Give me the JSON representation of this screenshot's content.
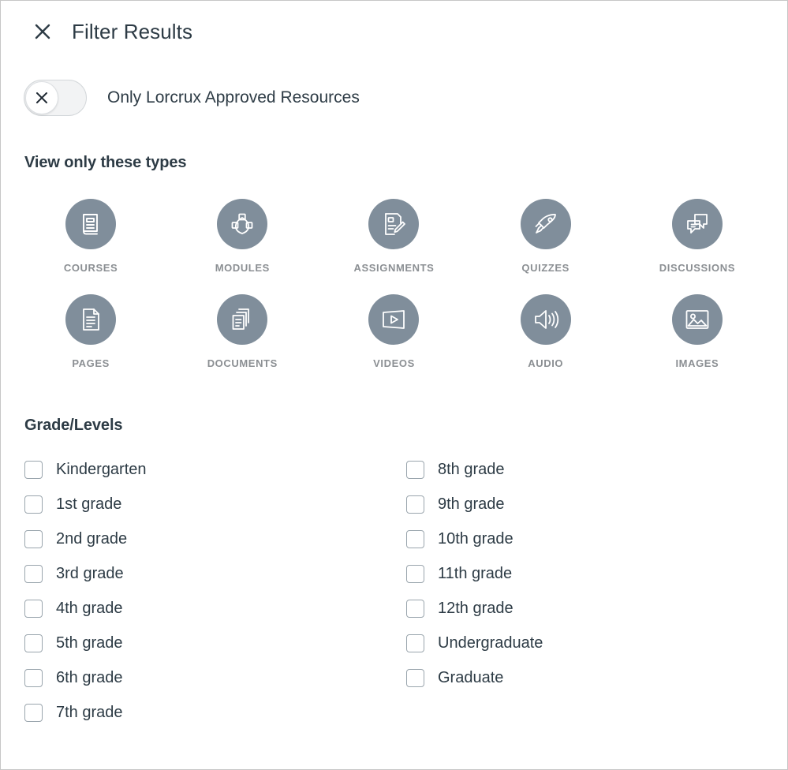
{
  "window": {
    "title": "Filter Results",
    "close_icon": "close-x-icon"
  },
  "colors": {
    "text_primary": "#2d3b45",
    "icon_circle": "#808e9b",
    "icon_caption": "#8b8f93",
    "checkbox_border": "#9aa5ad",
    "toggle_track": "#f2f3f4",
    "page_border": "#c7c7c7"
  },
  "approved_toggle": {
    "label": "Only Lorcrux Approved Resources",
    "state": "off",
    "knob_icon": "close-x-icon"
  },
  "types_section": {
    "heading": "View only these types",
    "items": [
      {
        "label": "COURSES",
        "icon": "book-icon"
      },
      {
        "label": "MODULES",
        "icon": "modules-network-icon"
      },
      {
        "label": "ASSIGNMENTS",
        "icon": "document-pencil-icon"
      },
      {
        "label": "QUIZZES",
        "icon": "rocket-icon"
      },
      {
        "label": "DISCUSSIONS",
        "icon": "speech-bubbles-icon"
      },
      {
        "label": "PAGES",
        "icon": "page-document-icon"
      },
      {
        "label": "DOCUMENTS",
        "icon": "stacked-documents-icon"
      },
      {
        "label": "VIDEOS",
        "icon": "video-play-icon"
      },
      {
        "label": "AUDIO",
        "icon": "speaker-audio-icon"
      },
      {
        "label": "IMAGES",
        "icon": "image-picture-icon"
      }
    ]
  },
  "grades_section": {
    "heading": "Grade/Levels",
    "left_column": [
      {
        "label": "Kindergarten",
        "checked": false
      },
      {
        "label": "1st grade",
        "checked": false
      },
      {
        "label": "2nd grade",
        "checked": false
      },
      {
        "label": "3rd grade",
        "checked": false
      },
      {
        "label": "4th grade",
        "checked": false
      },
      {
        "label": "5th grade",
        "checked": false
      },
      {
        "label": "6th grade",
        "checked": false
      },
      {
        "label": "7th grade",
        "checked": false
      }
    ],
    "right_column": [
      {
        "label": "8th grade",
        "checked": false
      },
      {
        "label": "9th grade",
        "checked": false
      },
      {
        "label": "10th grade",
        "checked": false
      },
      {
        "label": "11th grade",
        "checked": false
      },
      {
        "label": "12th grade",
        "checked": false
      },
      {
        "label": "Undergraduate",
        "checked": false
      },
      {
        "label": "Graduate",
        "checked": false
      }
    ]
  }
}
